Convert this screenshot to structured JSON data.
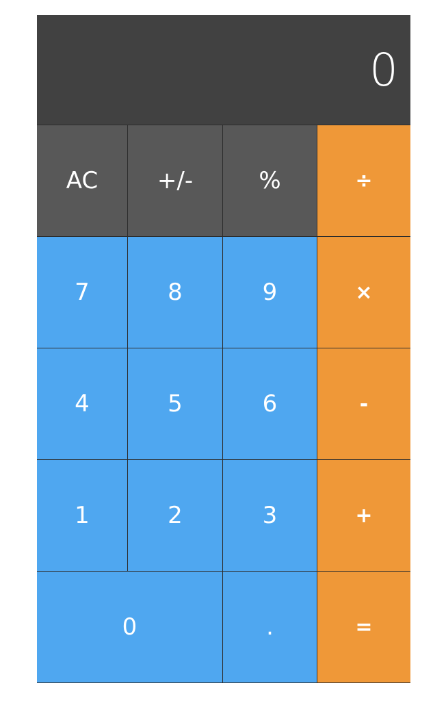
{
  "display": {
    "value": "0"
  },
  "colors": {
    "display_bg": "#414141",
    "function_key": "#585858",
    "digit_key": "#4fa7f0",
    "operator_key": "#ef9838",
    "key_text": "#ffffff"
  },
  "keys": {
    "clear": "AC",
    "sign": "+/-",
    "percent": "%",
    "divide": "÷",
    "seven": "7",
    "eight": "8",
    "nine": "9",
    "multiply": "×",
    "four": "4",
    "five": "5",
    "six": "6",
    "subtract": "-",
    "one": "1",
    "two": "2",
    "three": "3",
    "add": "+",
    "zero": "0",
    "decimal": ".",
    "equals": "="
  }
}
